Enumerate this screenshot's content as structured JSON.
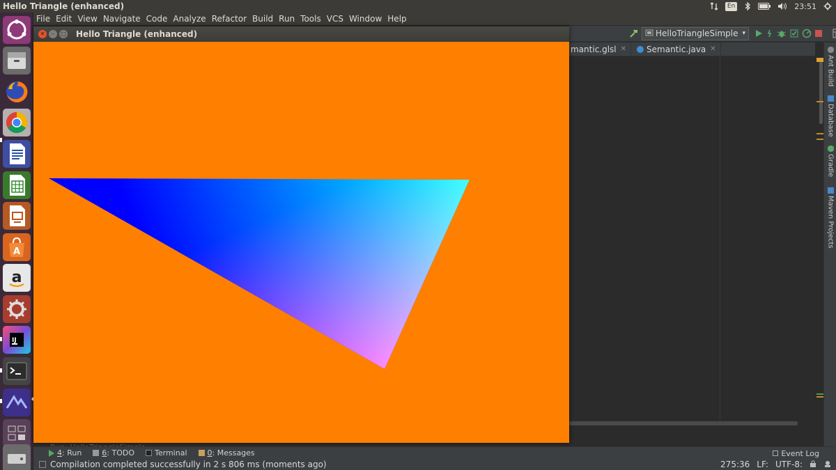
{
  "top_panel": {
    "title": "Hello Triangle (enhanced)",
    "lang": "En",
    "clock": "23:51"
  },
  "launcher": {
    "items": [
      {
        "name": "ubuntu-dash-icon"
      },
      {
        "name": "files-icon"
      },
      {
        "name": "firefox-icon"
      },
      {
        "name": "chrome-icon"
      },
      {
        "name": "writer-icon"
      },
      {
        "name": "calc-icon"
      },
      {
        "name": "impress-icon"
      },
      {
        "name": "software-center-icon"
      },
      {
        "name": "amazon-icon",
        "letter": "a"
      },
      {
        "name": "system-settings-icon"
      },
      {
        "name": "intellij-icon",
        "letter": "IJ"
      },
      {
        "name": "terminal-icon",
        "letter": ">_"
      },
      {
        "name": "ide-icon"
      },
      {
        "name": "workspace-switcher-icon"
      },
      {
        "name": "disk-icon"
      }
    ]
  },
  "menubar": {
    "items": [
      "File",
      "Edit",
      "View",
      "Navigate",
      "Code",
      "Analyze",
      "Refactor",
      "Build",
      "Run",
      "Tools",
      "VCS",
      "Window",
      "Help"
    ]
  },
  "toolbar": {
    "run_config": "HelloTriangleSimple"
  },
  "editor_tabs": [
    {
      "label": "mantic.glsl",
      "icon": "glsl-file-icon"
    },
    {
      "label": "Semantic.java",
      "icon": "java-class-icon"
    }
  ],
  "right_tools": [
    {
      "label": "Ant Build"
    },
    {
      "label": "Database"
    },
    {
      "label": "Gradle"
    },
    {
      "label": "Maven Projects"
    }
  ],
  "tool_window_bar": {
    "run": {
      "mnemonic": "4",
      "label": ": Run"
    },
    "todo": {
      "mnemonic": "6",
      "label": ": TODO"
    },
    "terminal": {
      "label": "Terminal"
    },
    "messages": {
      "mnemonic": "0",
      "label": ": Messages"
    },
    "event_log": "Event Log",
    "hidden_run_header": "Run:   HelloTriangleSimple"
  },
  "status_bar": {
    "message": "Compilation completed successfully in 2 s 806 ms (moments ago)",
    "position": "275:36",
    "line_sep": "LF:",
    "encoding": "UTF-8:"
  },
  "app_window": {
    "title": "Hello Triangle (enhanced)",
    "clear_color": "#ff7f00"
  },
  "colors": {
    "vertex_blue": "#0000ff",
    "vertex_green": "#00ff00",
    "vertex_red": "#ff0000"
  }
}
